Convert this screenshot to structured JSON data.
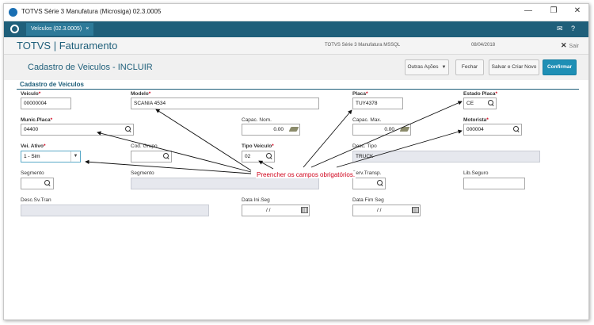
{
  "window": {
    "title": "TOTVS Série 3 Manufatura (Microsiga) 02.3.0005",
    "minimize": "—",
    "maximize": "❐",
    "close": "✕"
  },
  "tabbar": {
    "tab_label": "Veículos (02.3.0005)",
    "tab_close": "×",
    "mail_icon": "mail-icon",
    "help_icon": "help-icon"
  },
  "header": {
    "brand": "TOTVS | Faturamento",
    "environment": "TOTVS Série 3 Manufatura MSSQL",
    "date": "08/04/2018",
    "exit_label": "Sair"
  },
  "toolbar": {
    "page_title": "Cadastro de Veiculos - INCLUIR",
    "other_actions": "Outras Ações",
    "close": "Fechar",
    "save_new": "Salvar e Criar Novo",
    "confirm": "Confirmar"
  },
  "section": {
    "title": "Cadastro de Veiculos"
  },
  "fields": {
    "veiculo": {
      "label": "Veiculo",
      "value": "00000004"
    },
    "modelo": {
      "label": "Modelo",
      "value": "SCANIA 4534"
    },
    "placa": {
      "label": "Placa",
      "value": "TUY4378"
    },
    "estado_placa": {
      "label": "Estado Placa",
      "value": "CE"
    },
    "munic_placa": {
      "label": "Munic.Placa",
      "value": "04400"
    },
    "capac_nom": {
      "label": "Capac. Nom.",
      "value": "0.00"
    },
    "capac_max": {
      "label": "Capac. Max.",
      "value": "0.00"
    },
    "motorista": {
      "label": "Motorista",
      "value": "000004"
    },
    "vei_ativo": {
      "label": "Vei. Ativo",
      "value": "1 - Sim"
    },
    "cod_grupo": {
      "label": "Cod. Grupo",
      "value": ""
    },
    "tipo_veiculo": {
      "label": "Tipo Veiculo",
      "value": "02"
    },
    "desc_tipo": {
      "label": "Desc. Tipo",
      "value": "TRUCK"
    },
    "segmento": {
      "label": "Segmento",
      "value": ""
    },
    "segmento_desc": {
      "label": "Segmento",
      "value": ""
    },
    "serv_transp": {
      "label": "Serv.Transp.",
      "value": ""
    },
    "lib_seguro": {
      "label": "Lib.Seguro",
      "value": ""
    },
    "desc_sv_tran": {
      "label": "Desc.Sv.Tran",
      "value": ""
    },
    "data_ini_seg": {
      "label": "Data Ini.Seg",
      "value": "/ /"
    },
    "data_fim_seg": {
      "label": "Data Fim Seg",
      "value": "/ /"
    }
  },
  "required_mark": "*",
  "annotation": {
    "text": "Preencher os campos obrigatórios.",
    "color": "#d0021b"
  }
}
